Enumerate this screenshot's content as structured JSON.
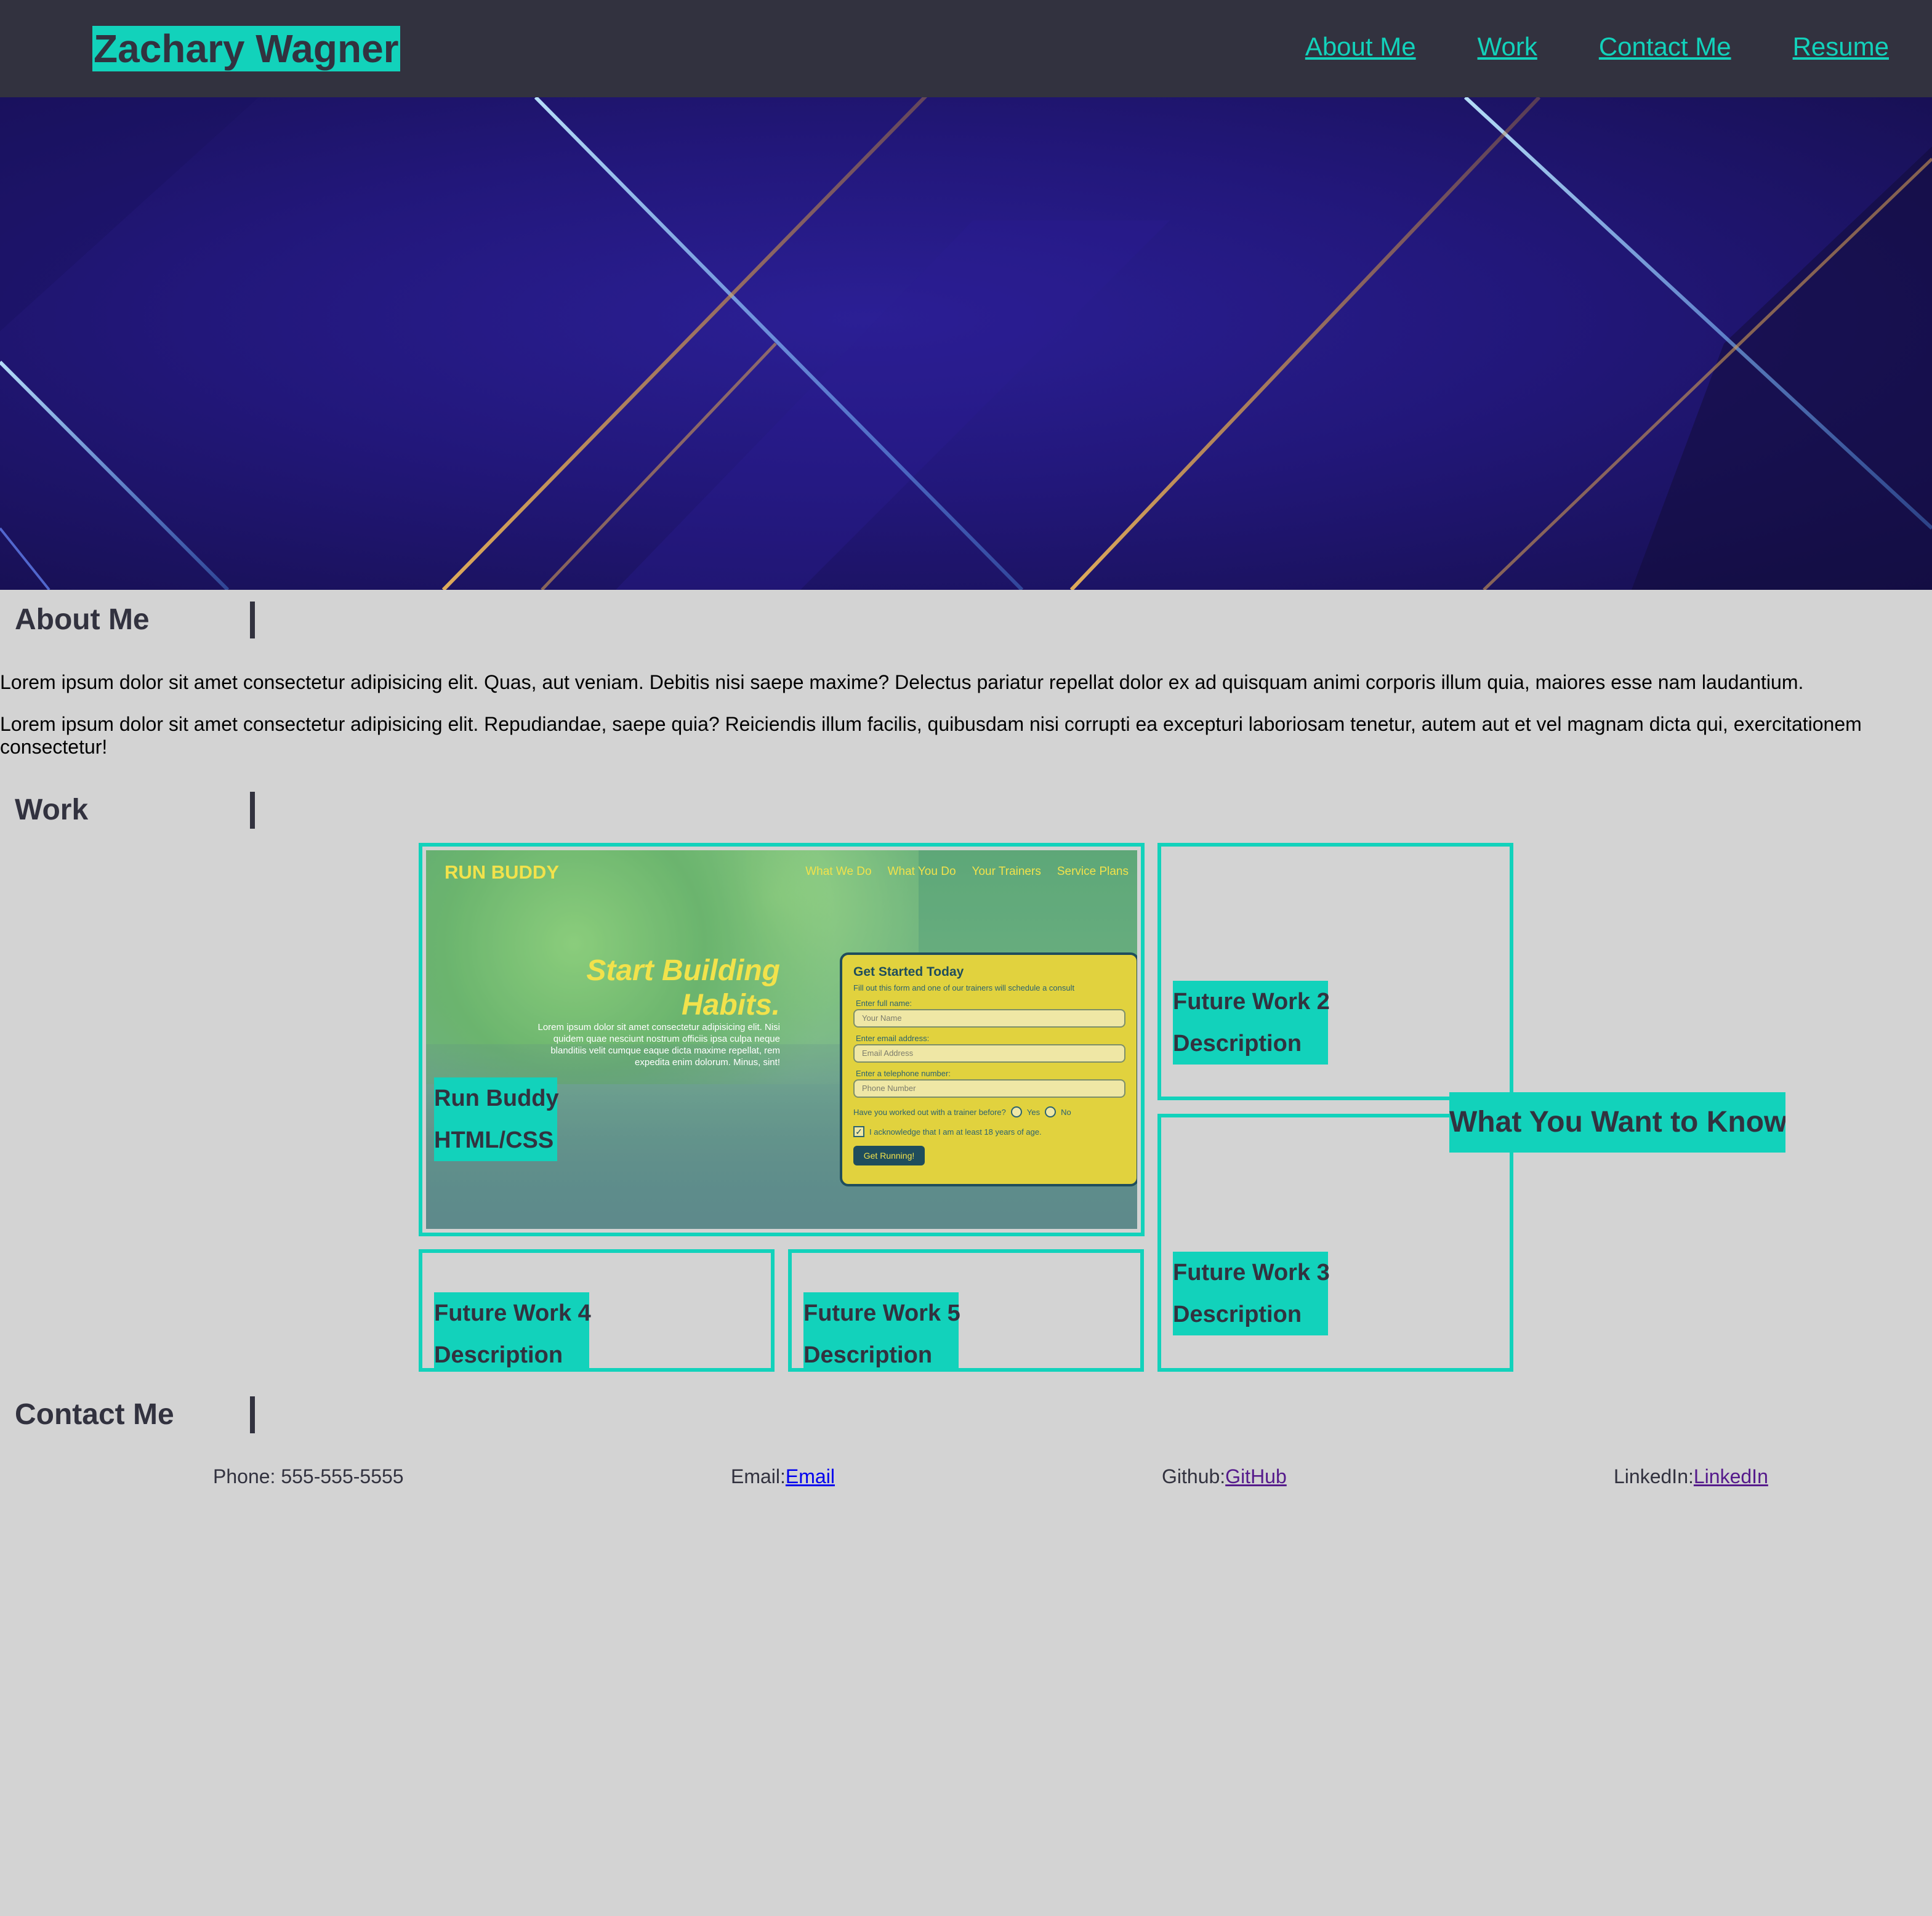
{
  "header": {
    "site_title": "Zachary Wagner",
    "nav": [
      "About Me",
      "Work",
      "Contact Me",
      "Resume"
    ]
  },
  "about": {
    "heading": "About Me",
    "paragraphs": [
      "Lorem ipsum dolor sit amet consectetur adipisicing elit. Quas, aut veniam. Debitis nisi saepe maxime? Delectus pariatur repellat dolor ex ad quisquam animi corporis illum quia, maiores esse nam laudantium.",
      "Lorem ipsum dolor sit amet consectetur adipisicing elit. Repudiandae, saepe quia? Reiciendis illum facilis, quibusdam nisi corrupti ea excepturi laboriosam tenetur, autem aut et vel magnam dicta qui, exercitationem consectetur!"
    ]
  },
  "work": {
    "heading": "Work",
    "featured": {
      "title": "Run Buddy",
      "subtitle": "HTML/CSS",
      "screenshot": {
        "logo": "RUN BUDDY",
        "nav": [
          "What We Do",
          "What You Do",
          "Your Trainers",
          "Service Plans"
        ],
        "headline_line1": "Start Building",
        "headline_line2": "Habits.",
        "body": "Lorem ipsum dolor sit amet consectetur adipisicing elit. Nisi quidem quae nesciunt nostrum officiis ipsa culpa neque blanditiis velit cumque eaque dicta maxime repellat, rem expedita enim dolorum. Minus, sint!",
        "form": {
          "title": "Get Started Today",
          "subtitle": "Fill out this form and one of our trainers will schedule a consult",
          "name_label": "Enter full name:",
          "name_placeholder": "Your Name",
          "email_label": "Enter email address:",
          "email_placeholder": "Email Address",
          "phone_label": "Enter a telephone number:",
          "phone_placeholder": "Phone Number",
          "trainer_question": "Have you worked out with a trainer before?",
          "yes": "Yes",
          "no": "No",
          "acknowledge": "I acknowledge that I am at least 18 years of age.",
          "button": "Get Running!"
        }
      }
    },
    "future": [
      {
        "title": "Future Work 2",
        "subtitle": "Description"
      },
      {
        "title": "Future Work 3",
        "subtitle": "Description"
      },
      {
        "title": "Future Work 4",
        "subtitle": "Description"
      },
      {
        "title": "Future Work 5",
        "subtitle": "Description"
      }
    ],
    "callout": "What You Want to Know"
  },
  "contact": {
    "heading": "Contact Me",
    "phone": "Phone: 555-555-5555",
    "email_label": "Email:",
    "email_link": "Email",
    "github_label": "Github:",
    "github_link": "GitHub",
    "linkedin_label": "LinkedIn:",
    "linkedin_link": "LinkedIn"
  },
  "colors": {
    "header_bg": "#32323f",
    "accent": "#12d2bb",
    "page_bg": "#d3d3d3"
  }
}
